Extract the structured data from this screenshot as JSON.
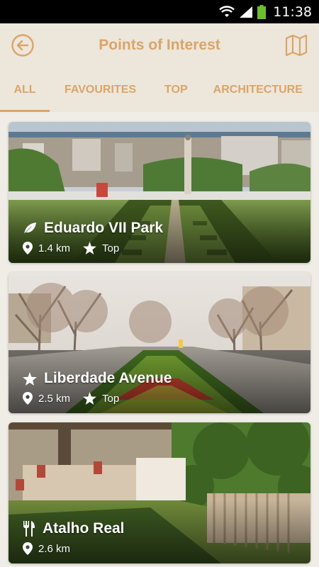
{
  "status": {
    "time": "11:38"
  },
  "header": {
    "title": "Points of Interest"
  },
  "tabs": [
    {
      "label": "ALL"
    },
    {
      "label": "FAVOURITES"
    },
    {
      "label": "TOP"
    },
    {
      "label": "ARCHITECTURE"
    }
  ],
  "items": [
    {
      "name": "Eduardo VII Park",
      "distance": "1.4 km",
      "badge": "Top",
      "category_icon": "leaf-icon"
    },
    {
      "name": "Liberdade Avenue",
      "distance": "2.5 km",
      "badge": "Top",
      "category_icon": "star-icon"
    },
    {
      "name": "Atalho Real",
      "distance": "2.6 km",
      "badge": "",
      "category_icon": "fork-knife-icon"
    }
  ],
  "colors": {
    "accent": "#d9a56a",
    "bar_background": "#ede6da",
    "page_background": "#f0ede6"
  }
}
